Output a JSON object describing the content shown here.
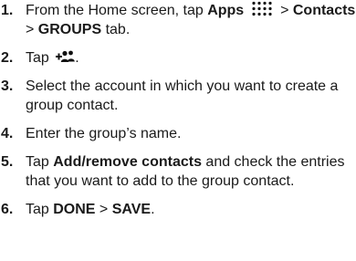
{
  "steps": [
    {
      "number": "1.",
      "pre": "From the Home screen, tap ",
      "apps_label": "Apps",
      "apps_icon": "apps-grid-icon",
      "sep1": " > ",
      "contacts_label": "Contacts",
      "sep2": " > ",
      "groups_label": "GROUPS",
      "post": " tab."
    },
    {
      "number": "2.",
      "pre": "Tap ",
      "icon": "add-group-icon",
      "post": "."
    },
    {
      "number": "3.",
      "text": "Select the account in which you want to create a group contact."
    },
    {
      "number": "4.",
      "text": "Enter the group’s name."
    },
    {
      "number": "5.",
      "pre": "Tap ",
      "bold": "Add/remove contacts",
      "post": " and check the entries that you want to add to the group contact."
    },
    {
      "number": "6.",
      "pre": "Tap ",
      "done_label": "DONE",
      "sep": " > ",
      "save_label": "SAVE",
      "post": "."
    }
  ],
  "colors": {
    "text": "#1a1a1a",
    "icon": "#111111"
  }
}
